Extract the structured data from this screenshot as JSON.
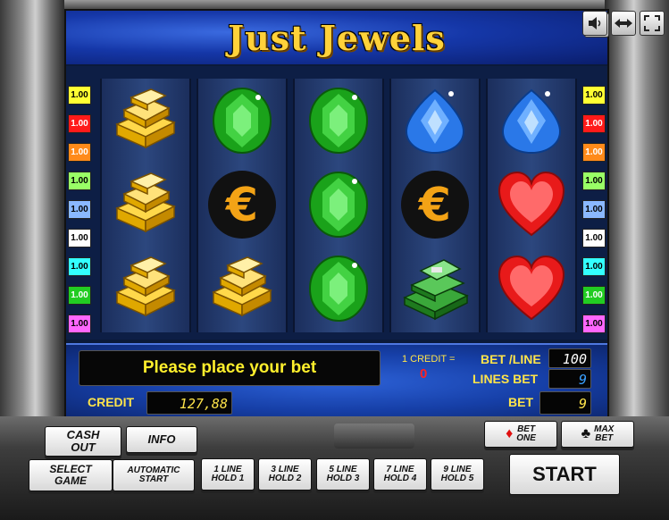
{
  "game": {
    "title": "Just Jewels"
  },
  "top_icons": [
    "speaker-icon",
    "resize-arrows-icon",
    "fullscreen-icon"
  ],
  "line_values_left": [
    "1.00",
    "1.00",
    "1.00",
    "1.00",
    "1.00",
    "1.00",
    "1.00",
    "1.00",
    "1.00"
  ],
  "line_values_right": [
    "1.00",
    "1.00",
    "1.00",
    "1.00",
    "1.00",
    "1.00",
    "1.00",
    "1.00",
    "1.00"
  ],
  "line_colors": [
    "#ffff33",
    "#ff1a1a",
    "#ff8a1a",
    "#99ff66",
    "#8ab8ff",
    "#ffffff",
    "#33ffff",
    "#22cc22",
    "#ff66ff"
  ],
  "reels": [
    [
      "gold-bars",
      "gold-bars",
      "gold-bars"
    ],
    [
      "green-emerald",
      "euro-coin",
      "gold-bars"
    ],
    [
      "green-emerald",
      "green-emerald",
      "green-emerald"
    ],
    [
      "blue-sapphire",
      "euro-coin",
      "money-stack"
    ],
    [
      "blue-sapphire",
      "red-heart",
      "red-heart"
    ]
  ],
  "status": {
    "message": "Please place your bet",
    "credit_label": "CREDIT",
    "credit_value": "127,88",
    "credit_rate_label": "1 CREDIT =",
    "credit_rate_value": "0",
    "bet_line_label": "BET /LINE",
    "bet_line_value": "100",
    "lines_bet_label": "LINES BET",
    "lines_bet_value": "9",
    "bet_label": "BET",
    "bet_value": "9"
  },
  "buttons": {
    "cash_out": "CASH\nOUT",
    "info": "INFO",
    "select_game": "SELECT\nGAME",
    "automatic_start": "AUTOMATIC\nSTART",
    "hold1": "1 LINE\nHOLD 1",
    "hold2": "3 LINE\nHOLD 2",
    "hold3": "5 LINE\nHOLD 3",
    "hold4": "7 LINE\nHOLD 4",
    "hold5": "9 LINE\nHOLD 5",
    "bet_one": "BET\nONE",
    "max_bet": "MAX\nBET",
    "start": "START"
  }
}
